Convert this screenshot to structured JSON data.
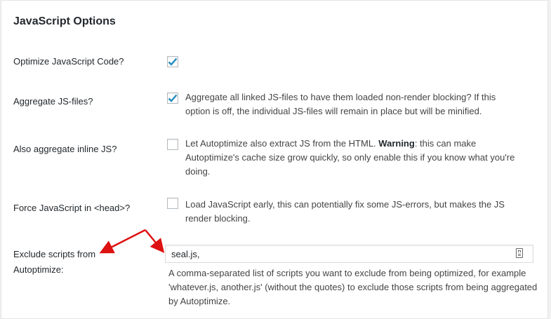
{
  "panel": {
    "title": "JavaScript Options"
  },
  "rows": [
    {
      "label": "Optimize JavaScript Code?",
      "checked": true,
      "description": ""
    },
    {
      "label": "Aggregate JS-files?",
      "checked": true,
      "description": "Aggregate all linked JS-files to have them loaded non-render blocking? If this option is off, the individual JS-files will remain in place but will be minified."
    },
    {
      "label": "Also aggregate inline JS?",
      "checked": false,
      "description_before": "Let Autoptimize also extract JS from the HTML.",
      "description_bold": "Warning",
      "description_after": ": this can make Autoptimize's cache size grow quickly, so only enable this if you know what you're doing."
    },
    {
      "label": "Force JavaScript in <head>?",
      "checked": false,
      "description": "Load JavaScript early, this can potentially fix some JS-errors, but makes the JS render blocking."
    }
  ],
  "exclude": {
    "label": "Exclude scripts from Autoptimize:",
    "value": "seal.js,",
    "help": "A comma-separated list of scripts you want to exclude from being optimized, for example 'whatever.js, another.js' (without the quotes) to exclude those scripts from being aggregated by Autoptimize."
  },
  "colors": {
    "checkmark": "#1e8cbe",
    "annotation_arrow": "#dd1111"
  }
}
